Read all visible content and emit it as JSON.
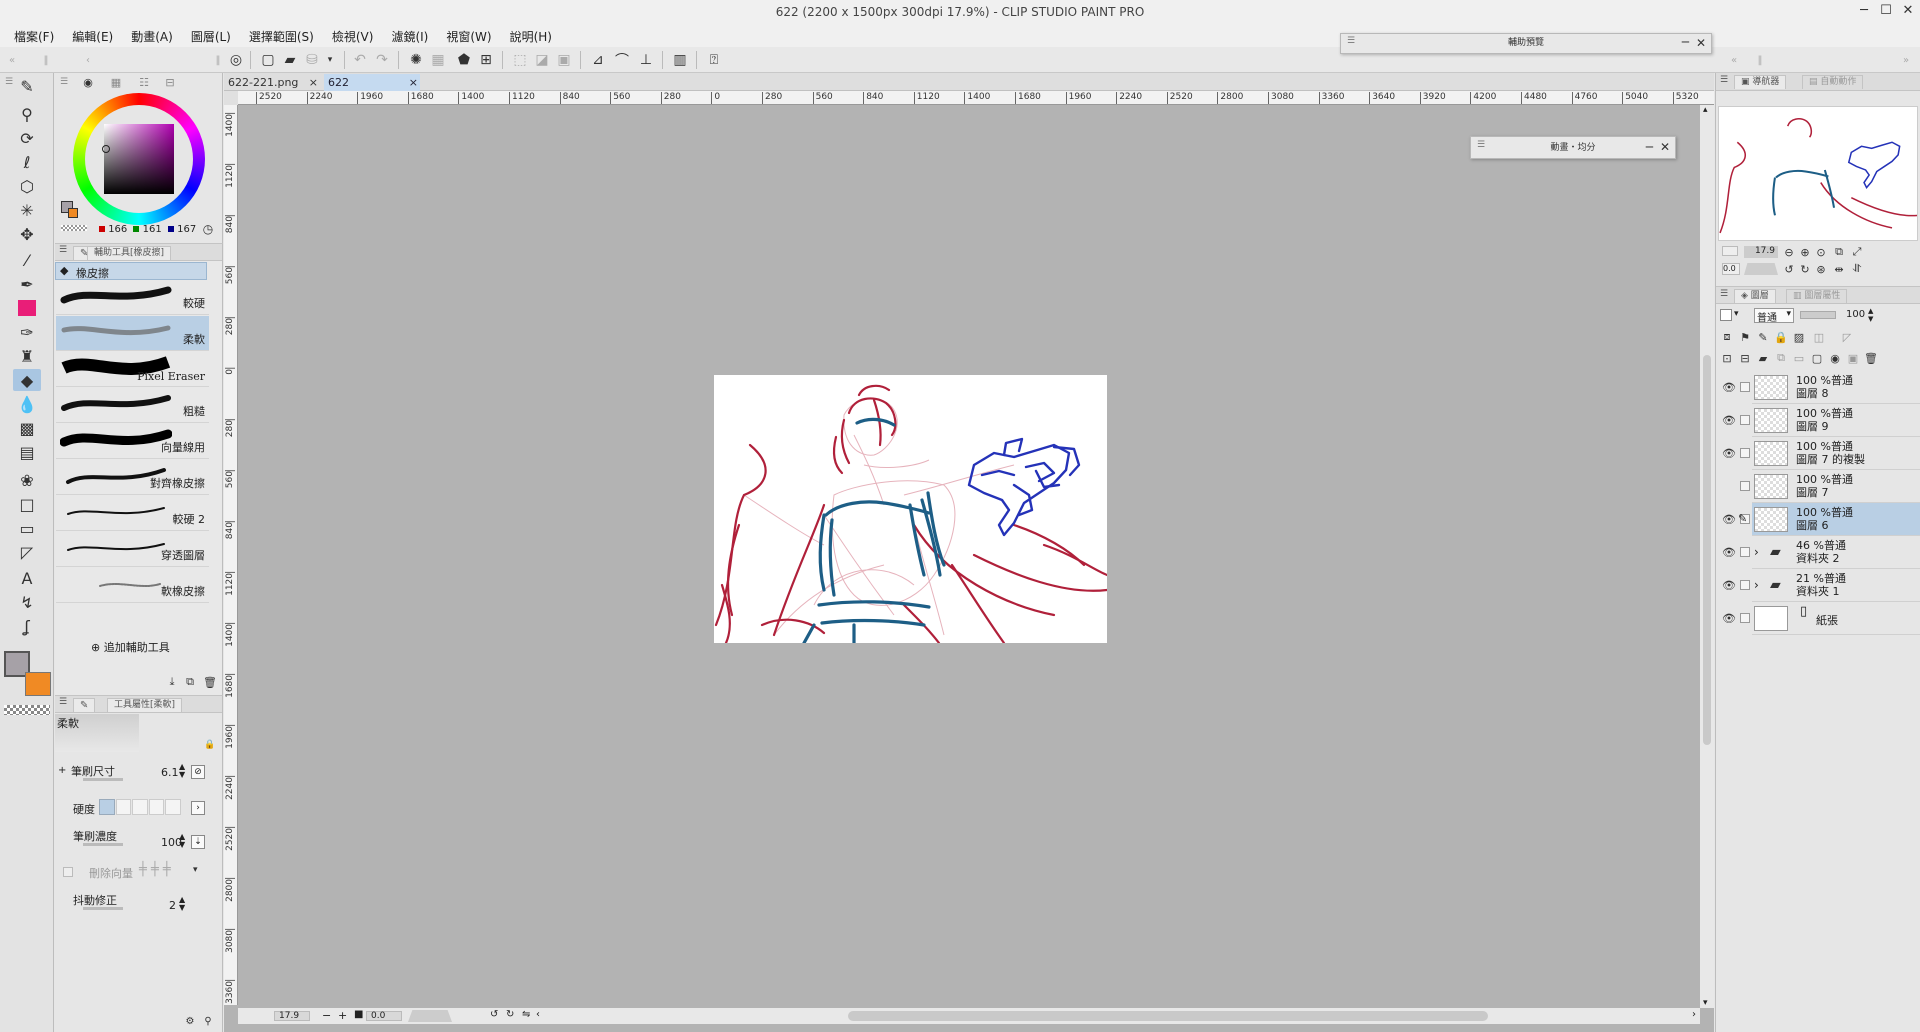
{
  "window": {
    "title": "622 (2200 x 1500px 300dpi 17.9%) - CLIP STUDIO PAINT PRO",
    "minimize": "─",
    "maximize": "☐",
    "close": "✕"
  },
  "menu": [
    "檔案(F)",
    "編輯(E)",
    "動畫(A)",
    "圖層(L)",
    "選擇範圍(S)",
    "檢視(V)",
    "濾鏡(I)",
    "視窗(W)",
    "說明(H)"
  ],
  "float_windows": {
    "preview": {
      "title": "輔助預覽"
    },
    "animation": {
      "title": "動畫・均分"
    }
  },
  "document_tabs": [
    {
      "label": "622-221.png",
      "close": "×",
      "active": false
    },
    {
      "label": "622",
      "close": "×",
      "active": true
    }
  ],
  "ruler": {
    "h_ticks": [
      "2520",
      "2240",
      "1960",
      "1680",
      "1400",
      "1120",
      "840",
      "560",
      "280",
      "0",
      "280",
      "560",
      "840",
      "1120",
      "1400",
      "1680",
      "1960",
      "2240",
      "2520",
      "2800",
      "3080",
      "3360",
      "3640",
      "3920",
      "4200",
      "4480",
      "4760",
      "5040",
      "5320"
    ],
    "v_ticks": [
      "1400",
      "1120",
      "840",
      "560",
      "280",
      "0",
      "280",
      "560",
      "840",
      "1120",
      "1400",
      "1680",
      "1960",
      "2240",
      "2520",
      "2800",
      "3080",
      "3360"
    ]
  },
  "color": {
    "r": "166",
    "g": "161",
    "b": "167",
    "main": "#a6a1a7",
    "sub": "#f08a24",
    "accent": "#e91e78"
  },
  "subtool": {
    "panel_title": "輔助工具[橡皮擦]",
    "group": "橡皮擦",
    "brushes": [
      "較硬",
      "柔軟",
      "Pixel Eraser",
      "粗糙",
      "向量線用",
      "對齊橡皮擦",
      "較硬 2",
      "穿透圖層",
      "軟橡皮擦"
    ],
    "selected_index": 1,
    "add_label": "追加輔助工具"
  },
  "properties": {
    "panel_title": "工具屬性[柔軟]",
    "preview_label": "柔軟",
    "brush_size_label": "筆刷尺寸",
    "brush_size_value": "6.1",
    "hardness_label": "硬度",
    "density_label": "筆刷濃度",
    "density_value": "100",
    "delete_vector_label": "刪除向量",
    "stabilization_label": "抖動修正",
    "stabilization_value": "2"
  },
  "statusbar": {
    "zoom": "17.9",
    "angle": "0.0"
  },
  "navigator": {
    "tab1": "導航器",
    "tab2": "自動動作",
    "zoom": "17.9",
    "angle": "0.0"
  },
  "layers": {
    "tab1": "圖層",
    "tab2": "圖層屬性",
    "blend": "普通",
    "opacity": "100",
    "items": [
      {
        "line1": "100 %普通",
        "line2": "圖層 8",
        "visible": true,
        "selected": false,
        "folder": false
      },
      {
        "line1": "100 %普通",
        "line2": "圖層 9",
        "visible": true,
        "selected": false,
        "folder": false
      },
      {
        "line1": "100 %普通",
        "line2": "圖層 7 的複製",
        "visible": true,
        "selected": false,
        "folder": false
      },
      {
        "line1": "100 %普通",
        "line2": "圖層 7",
        "visible": false,
        "selected": false,
        "folder": false
      },
      {
        "line1": "100 %普通",
        "line2": "圖層 6",
        "visible": true,
        "selected": true,
        "folder": false
      },
      {
        "line1": "46 %普通",
        "line2": "資料夾 2",
        "visible": true,
        "selected": false,
        "folder": true
      },
      {
        "line1": "21 %普通",
        "line2": "資料夾 1",
        "visible": true,
        "selected": false,
        "folder": true
      },
      {
        "line1": "",
        "line2": "紙張",
        "visible": true,
        "selected": false,
        "folder": false
      }
    ]
  }
}
